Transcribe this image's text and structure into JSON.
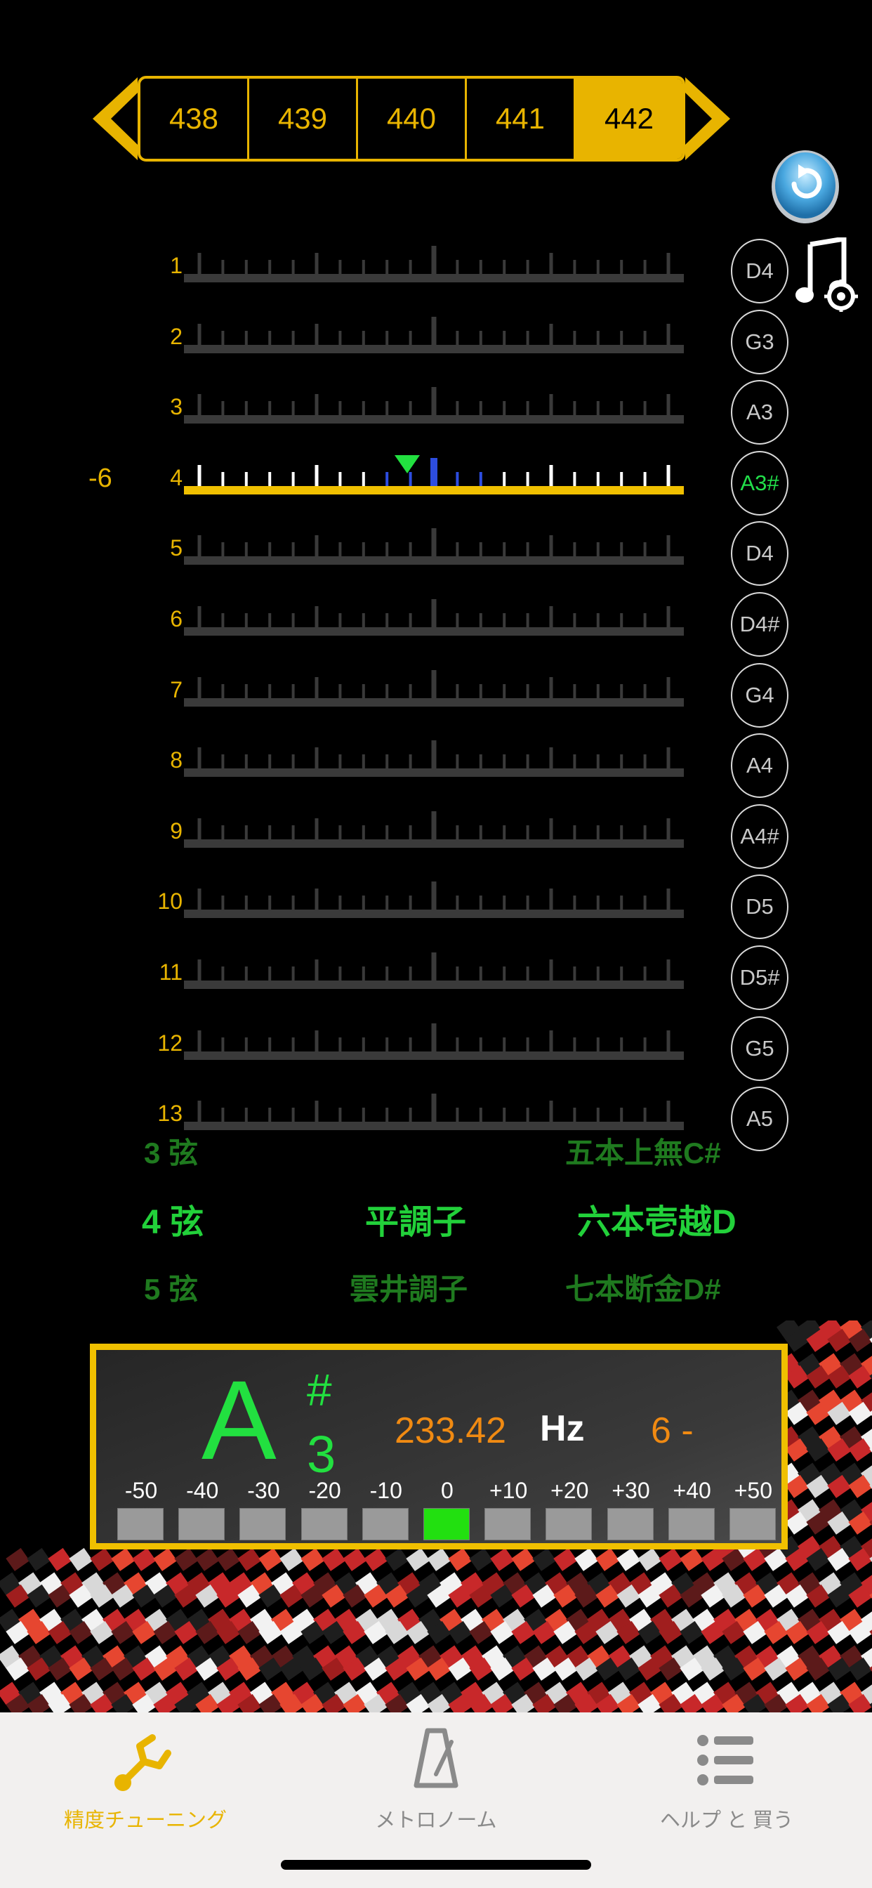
{
  "frequency_selector": {
    "options": [
      "438",
      "439",
      "440",
      "441",
      "442"
    ],
    "selected": "442"
  },
  "strings": [
    {
      "num": "1",
      "note": "D4"
    },
    {
      "num": "2",
      "note": "G3"
    },
    {
      "num": "3",
      "note": "A3"
    },
    {
      "num": "4",
      "note": "A3#",
      "active": true,
      "offset": "-6"
    },
    {
      "num": "5",
      "note": "D4"
    },
    {
      "num": "6",
      "note": "D4#"
    },
    {
      "num": "7",
      "note": "G4"
    },
    {
      "num": "8",
      "note": "A4"
    },
    {
      "num": "9",
      "note": "A4#"
    },
    {
      "num": "10",
      "note": "D5"
    },
    {
      "num": "11",
      "note": "D5#"
    },
    {
      "num": "12",
      "note": "G5"
    },
    {
      "num": "13",
      "note": "A5"
    }
  ],
  "picker": {
    "prev": {
      "string": "3 弦",
      "tuning": "五本上無C#"
    },
    "current": {
      "string": "4 弦",
      "mode": "平調子",
      "tuning": "六本壱越D"
    },
    "next": {
      "string": "5 弦",
      "mode": "雲井調子",
      "tuning": "七本断金D#"
    }
  },
  "readout": {
    "note": "A",
    "sharp": "#",
    "octave": "3",
    "frequency": "233.42",
    "unit": "Hz",
    "deviation": "6 -",
    "cent_labels": [
      "-50",
      "-40",
      "-30",
      "-20",
      "-10",
      "0",
      "+10",
      "+20",
      "+30",
      "+40",
      "+50"
    ],
    "active_cent": "0"
  },
  "tabs": [
    {
      "label": "精度チューニング",
      "icon": "tuning-fork-icon",
      "active": true
    },
    {
      "label": "メトロノーム",
      "icon": "metronome-icon",
      "active": false
    },
    {
      "label": "ヘルプ と 買う",
      "icon": "list-icon",
      "active": false
    }
  ],
  "colors": {
    "accent": "#e8b400",
    "note_green": "#22e040",
    "frequency_orange": "#f08a12",
    "tab_bg": "#f2f0ef"
  }
}
